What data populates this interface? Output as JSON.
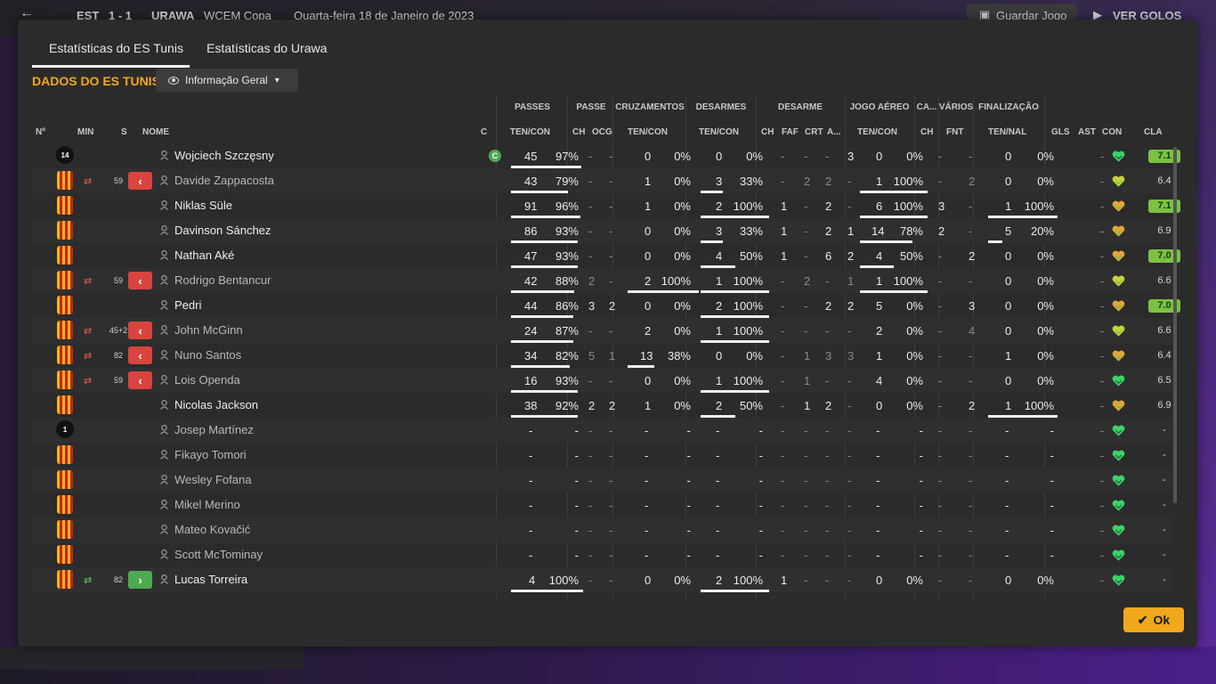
{
  "topbar": {
    "team_home": "EST",
    "score": "1 - 1",
    "team_away": "URAWA",
    "competition": "WCEM Copa",
    "date": "Quarta-feira 18 de Janeiro de 2023",
    "save_label": "Guardar Jogo",
    "goals_label": "VER GOLOS"
  },
  "tabs": [
    {
      "label": "Estatísticas do ES Tunis",
      "active": true
    },
    {
      "label": "Estatísticas do Urawa",
      "active": false
    }
  ],
  "section": {
    "title": "DADOS DO ES TUNIS",
    "dropdown_label": "Informação Geral"
  },
  "group_headers": [
    "PASSES",
    "PASSE",
    "CRUZAMENTOS",
    "DESARMES",
    "DESARME",
    "JOGO AÉREO",
    "CA...",
    "VÁRIOS",
    "FINALIZAÇÃO"
  ],
  "column_headers": {
    "no": "Nº",
    "min": "MIN",
    "s": "S",
    "nome": "NOME",
    "c": "C",
    "passes": "TEN/CON",
    "passe_ch": "CH",
    "passe_ocg": "OCG",
    "cruz": "TEN/CON",
    "desarmes": "TEN/CON",
    "des_ch": "CH",
    "des_faf": "FAF",
    "des_crt": "CRT",
    "des_a": "A...",
    "aereo": "TEN/CON",
    "ca_ch": "CH",
    "var_fnt": "FNT",
    "fin": "TEN/NAL",
    "gls": "GLS",
    "ast": "AST",
    "con": "CON",
    "cla": "CLA"
  },
  "players": [
    {
      "num": "14",
      "gk": true,
      "name": "Wojciech Szczęsny",
      "active": true,
      "captain": "C",
      "sub": null,
      "p": [
        "45",
        "97%"
      ],
      "pch": "-",
      "pocg": "-",
      "cr": [
        "0",
        "0%"
      ],
      "de": [
        "0",
        "0%"
      ],
      "dch": "-",
      "dfaf": "-",
      "dcrt": "-",
      "da": "3",
      "ae": [
        "0",
        "0%"
      ],
      "cach": "-",
      "fnt": "-",
      "fi": [
        "0",
        "0%"
      ],
      "gls": "",
      "ast": "-",
      "con": "green",
      "cla": "7.1",
      "hi": true
    },
    {
      "num": "",
      "gk": false,
      "name": "Davide Zappacosta",
      "active": false,
      "captain": "",
      "sub": {
        "dir": "out",
        "min": "59"
      },
      "p": [
        "43",
        "79%"
      ],
      "pch": "-",
      "pocg": "-",
      "cr": [
        "1",
        "0%"
      ],
      "de": [
        "3",
        "33%"
      ],
      "dch": "-",
      "dfaf": "2",
      "dcrt": "2",
      "da": "-",
      "ae": [
        "1",
        "100%"
      ],
      "cach": "-",
      "fnt": "2",
      "fi": [
        "0",
        "0%"
      ],
      "gls": "",
      "ast": "-",
      "con": "yellow",
      "cla": "6.4",
      "hi": false
    },
    {
      "num": "",
      "gk": false,
      "name": "Niklas Süle",
      "active": true,
      "captain": "",
      "sub": null,
      "p": [
        "91",
        "96%"
      ],
      "pch": "-",
      "pocg": "-",
      "cr": [
        "1",
        "0%"
      ],
      "de": [
        "2",
        "100%"
      ],
      "dch": "1",
      "dfaf": "-",
      "dcrt": "2",
      "da": "-",
      "ae": [
        "6",
        "100%"
      ],
      "cach": "3",
      "fnt": "-",
      "fi": [
        "1",
        "100%"
      ],
      "gls": "",
      "ast": "-",
      "con": "orange",
      "cla": "7.1",
      "hi": true
    },
    {
      "num": "",
      "gk": false,
      "name": "Davinson Sánchez",
      "active": true,
      "captain": "",
      "sub": null,
      "p": [
        "86",
        "93%"
      ],
      "pch": "-",
      "pocg": "-",
      "cr": [
        "0",
        "0%"
      ],
      "de": [
        "3",
        "33%"
      ],
      "dch": "1",
      "dfaf": "-",
      "dcrt": "2",
      "da": "1",
      "ae": [
        "14",
        "78%"
      ],
      "cach": "2",
      "fnt": "-",
      "fi": [
        "5",
        "20%"
      ],
      "gls": "",
      "ast": "-",
      "con": "orange",
      "cla": "6.9",
      "hi": false
    },
    {
      "num": "",
      "gk": false,
      "name": "Nathan Aké",
      "active": true,
      "captain": "",
      "sub": null,
      "p": [
        "47",
        "93%"
      ],
      "pch": "-",
      "pocg": "-",
      "cr": [
        "0",
        "0%"
      ],
      "de": [
        "4",
        "50%"
      ],
      "dch": "1",
      "dfaf": "-",
      "dcrt": "6",
      "da": "2",
      "ae": [
        "4",
        "50%"
      ],
      "cach": "-",
      "fnt": "2",
      "fi": [
        "0",
        "0%"
      ],
      "gls": "",
      "ast": "-",
      "con": "orange",
      "cla": "7.0",
      "hi": true
    },
    {
      "num": "",
      "gk": false,
      "name": "Rodrigo Bentancur",
      "active": false,
      "captain": "",
      "sub": {
        "dir": "out",
        "min": "59"
      },
      "p": [
        "42",
        "88%"
      ],
      "pch": "2",
      "pocg": "-",
      "cr": [
        "2",
        "100%"
      ],
      "de": [
        "1",
        "100%"
      ],
      "dch": "-",
      "dfaf": "2",
      "dcrt": "-",
      "da": "1",
      "ae": [
        "1",
        "100%"
      ],
      "cach": "-",
      "fnt": "-",
      "fi": [
        "0",
        "0%"
      ],
      "gls": "",
      "ast": "-",
      "con": "yellow",
      "cla": "6.6",
      "hi": false
    },
    {
      "num": "",
      "gk": false,
      "name": "Pedri",
      "active": true,
      "captain": "",
      "sub": null,
      "p": [
        "44",
        "86%"
      ],
      "pch": "3",
      "pocg": "2",
      "cr": [
        "0",
        "0%"
      ],
      "de": [
        "2",
        "100%"
      ],
      "dch": "-",
      "dfaf": "-",
      "dcrt": "2",
      "da": "2",
      "ae": [
        "5",
        "0%"
      ],
      "cach": "-",
      "fnt": "3",
      "fi": [
        "0",
        "0%"
      ],
      "gls": "",
      "ast": "-",
      "con": "orange",
      "cla": "7.0",
      "hi": true
    },
    {
      "num": "",
      "gk": false,
      "name": "John McGinn",
      "active": false,
      "captain": "",
      "sub": {
        "dir": "out",
        "min": "45+2"
      },
      "p": [
        "24",
        "87%"
      ],
      "pch": "-",
      "pocg": "-",
      "cr": [
        "2",
        "0%"
      ],
      "de": [
        "1",
        "100%"
      ],
      "dch": "-",
      "dfaf": "-",
      "dcrt": "-",
      "da": "-",
      "ae": [
        "2",
        "0%"
      ],
      "cach": "-",
      "fnt": "4",
      "fi": [
        "0",
        "0%"
      ],
      "gls": "",
      "ast": "-",
      "con": "yellow",
      "cla": "6.6",
      "hi": false
    },
    {
      "num": "",
      "gk": false,
      "name": "Nuno Santos",
      "active": false,
      "captain": "",
      "sub": {
        "dir": "out",
        "min": "82"
      },
      "p": [
        "34",
        "82%"
      ],
      "pch": "5",
      "pocg": "1",
      "cr": [
        "13",
        "38%"
      ],
      "de": [
        "0",
        "0%"
      ],
      "dch": "-",
      "dfaf": "1",
      "dcrt": "3",
      "da": "3",
      "ae": [
        "1",
        "0%"
      ],
      "cach": "-",
      "fnt": "-",
      "fi": [
        "1",
        "0%"
      ],
      "gls": "",
      "ast": "-",
      "con": "orange",
      "cla": "6.4",
      "hi": false
    },
    {
      "num": "",
      "gk": false,
      "name": "Lois Openda",
      "active": false,
      "captain": "",
      "sub": {
        "dir": "out",
        "min": "59"
      },
      "p": [
        "16",
        "93%"
      ],
      "pch": "-",
      "pocg": "-",
      "cr": [
        "0",
        "0%"
      ],
      "de": [
        "1",
        "100%"
      ],
      "dch": "-",
      "dfaf": "1",
      "dcrt": "-",
      "da": "-",
      "ae": [
        "4",
        "0%"
      ],
      "cach": "-",
      "fnt": "-",
      "fi": [
        "0",
        "0%"
      ],
      "gls": "",
      "ast": "-",
      "con": "green",
      "cla": "6.5",
      "hi": false
    },
    {
      "num": "",
      "gk": false,
      "name": "Nicolas Jackson",
      "active": true,
      "captain": "",
      "sub": null,
      "p": [
        "38",
        "92%"
      ],
      "pch": "2",
      "pocg": "2",
      "cr": [
        "1",
        "0%"
      ],
      "de": [
        "2",
        "50%"
      ],
      "dch": "-",
      "dfaf": "1",
      "dcrt": "2",
      "da": "-",
      "ae": [
        "0",
        "0%"
      ],
      "cach": "-",
      "fnt": "2",
      "fi": [
        "1",
        "100%"
      ],
      "gls": "",
      "ast": "-",
      "con": "orange",
      "cla": "6.9",
      "hi": false
    },
    {
      "num": "1",
      "gk": true,
      "name": "Josep Martínez",
      "active": false,
      "captain": "",
      "sub": null,
      "p": [
        "-",
        "-"
      ],
      "pch": "-",
      "pocg": "-",
      "cr": [
        "-",
        "-"
      ],
      "de": [
        "-",
        "-"
      ],
      "dch": "-",
      "dfaf": "-",
      "dcrt": "-",
      "da": "-",
      "ae": [
        "-",
        "-"
      ],
      "cach": "-",
      "fnt": "-",
      "fi": [
        "-",
        "-"
      ],
      "gls": "",
      "ast": "-",
      "con": "green",
      "cla": "-",
      "hi": false
    },
    {
      "num": "",
      "gk": false,
      "name": "Fikayo Tomori",
      "active": false,
      "captain": "",
      "sub": null,
      "p": [
        "-",
        "-"
      ],
      "pch": "-",
      "pocg": "-",
      "cr": [
        "-",
        "-"
      ],
      "de": [
        "-",
        "-"
      ],
      "dch": "-",
      "dfaf": "-",
      "dcrt": "-",
      "da": "-",
      "ae": [
        "-",
        "-"
      ],
      "cach": "-",
      "fnt": "-",
      "fi": [
        "-",
        "-"
      ],
      "gls": "",
      "ast": "-",
      "con": "green",
      "cla": "-",
      "hi": false
    },
    {
      "num": "",
      "gk": false,
      "name": "Wesley Fofana",
      "active": false,
      "captain": "",
      "sub": null,
      "p": [
        "-",
        "-"
      ],
      "pch": "-",
      "pocg": "-",
      "cr": [
        "-",
        "-"
      ],
      "de": [
        "-",
        "-"
      ],
      "dch": "-",
      "dfaf": "-",
      "dcrt": "-",
      "da": "-",
      "ae": [
        "-",
        "-"
      ],
      "cach": "-",
      "fnt": "-",
      "fi": [
        "-",
        "-"
      ],
      "gls": "",
      "ast": "-",
      "con": "green",
      "cla": "-",
      "hi": false
    },
    {
      "num": "",
      "gk": false,
      "name": "Mikel Merino",
      "active": false,
      "captain": "",
      "sub": null,
      "p": [
        "-",
        "-"
      ],
      "pch": "-",
      "pocg": "-",
      "cr": [
        "-",
        "-"
      ],
      "de": [
        "-",
        "-"
      ],
      "dch": "-",
      "dfaf": "-",
      "dcrt": "-",
      "da": "-",
      "ae": [
        "-",
        "-"
      ],
      "cach": "-",
      "fnt": "-",
      "fi": [
        "-",
        "-"
      ],
      "gls": "",
      "ast": "-",
      "con": "green",
      "cla": "-",
      "hi": false
    },
    {
      "num": "",
      "gk": false,
      "name": "Mateo Kovačić",
      "active": false,
      "captain": "",
      "sub": null,
      "p": [
        "-",
        "-"
      ],
      "pch": "-",
      "pocg": "-",
      "cr": [
        "-",
        "-"
      ],
      "de": [
        "-",
        "-"
      ],
      "dch": "-",
      "dfaf": "-",
      "dcrt": "-",
      "da": "-",
      "ae": [
        "-",
        "-"
      ],
      "cach": "-",
      "fnt": "-",
      "fi": [
        "-",
        "-"
      ],
      "gls": "",
      "ast": "-",
      "con": "green",
      "cla": "-",
      "hi": false
    },
    {
      "num": "",
      "gk": false,
      "name": "Scott McTominay",
      "active": false,
      "captain": "",
      "sub": null,
      "p": [
        "-",
        "-"
      ],
      "pch": "-",
      "pocg": "-",
      "cr": [
        "-",
        "-"
      ],
      "de": [
        "-",
        "-"
      ],
      "dch": "-",
      "dfaf": "-",
      "dcrt": "-",
      "da": "-",
      "ae": [
        "-",
        "-"
      ],
      "cach": "-",
      "fnt": "-",
      "fi": [
        "-",
        "-"
      ],
      "gls": "",
      "ast": "-",
      "con": "green",
      "cla": "-",
      "hi": false
    },
    {
      "num": "",
      "gk": false,
      "name": "Lucas Torreira",
      "active": true,
      "captain": "",
      "sub": {
        "dir": "in",
        "min": "82"
      },
      "p": [
        "4",
        "100%"
      ],
      "pch": "-",
      "pocg": "-",
      "cr": [
        "0",
        "0%"
      ],
      "de": [
        "2",
        "100%"
      ],
      "dch": "1",
      "dfaf": "-",
      "dcrt": "-",
      "da": "-",
      "ae": [
        "0",
        "0%"
      ],
      "cach": "-",
      "fnt": "-",
      "fi": [
        "0",
        "0%"
      ],
      "gls": "",
      "ast": "-",
      "con": "green",
      "cla": "-",
      "hi": false
    }
  ],
  "ok_label": "Ok",
  "colors": {
    "accent": "#f2a81d",
    "sub_out": "#d9443f",
    "sub_in": "#4caa52",
    "rating_high": "#7bc142"
  }
}
